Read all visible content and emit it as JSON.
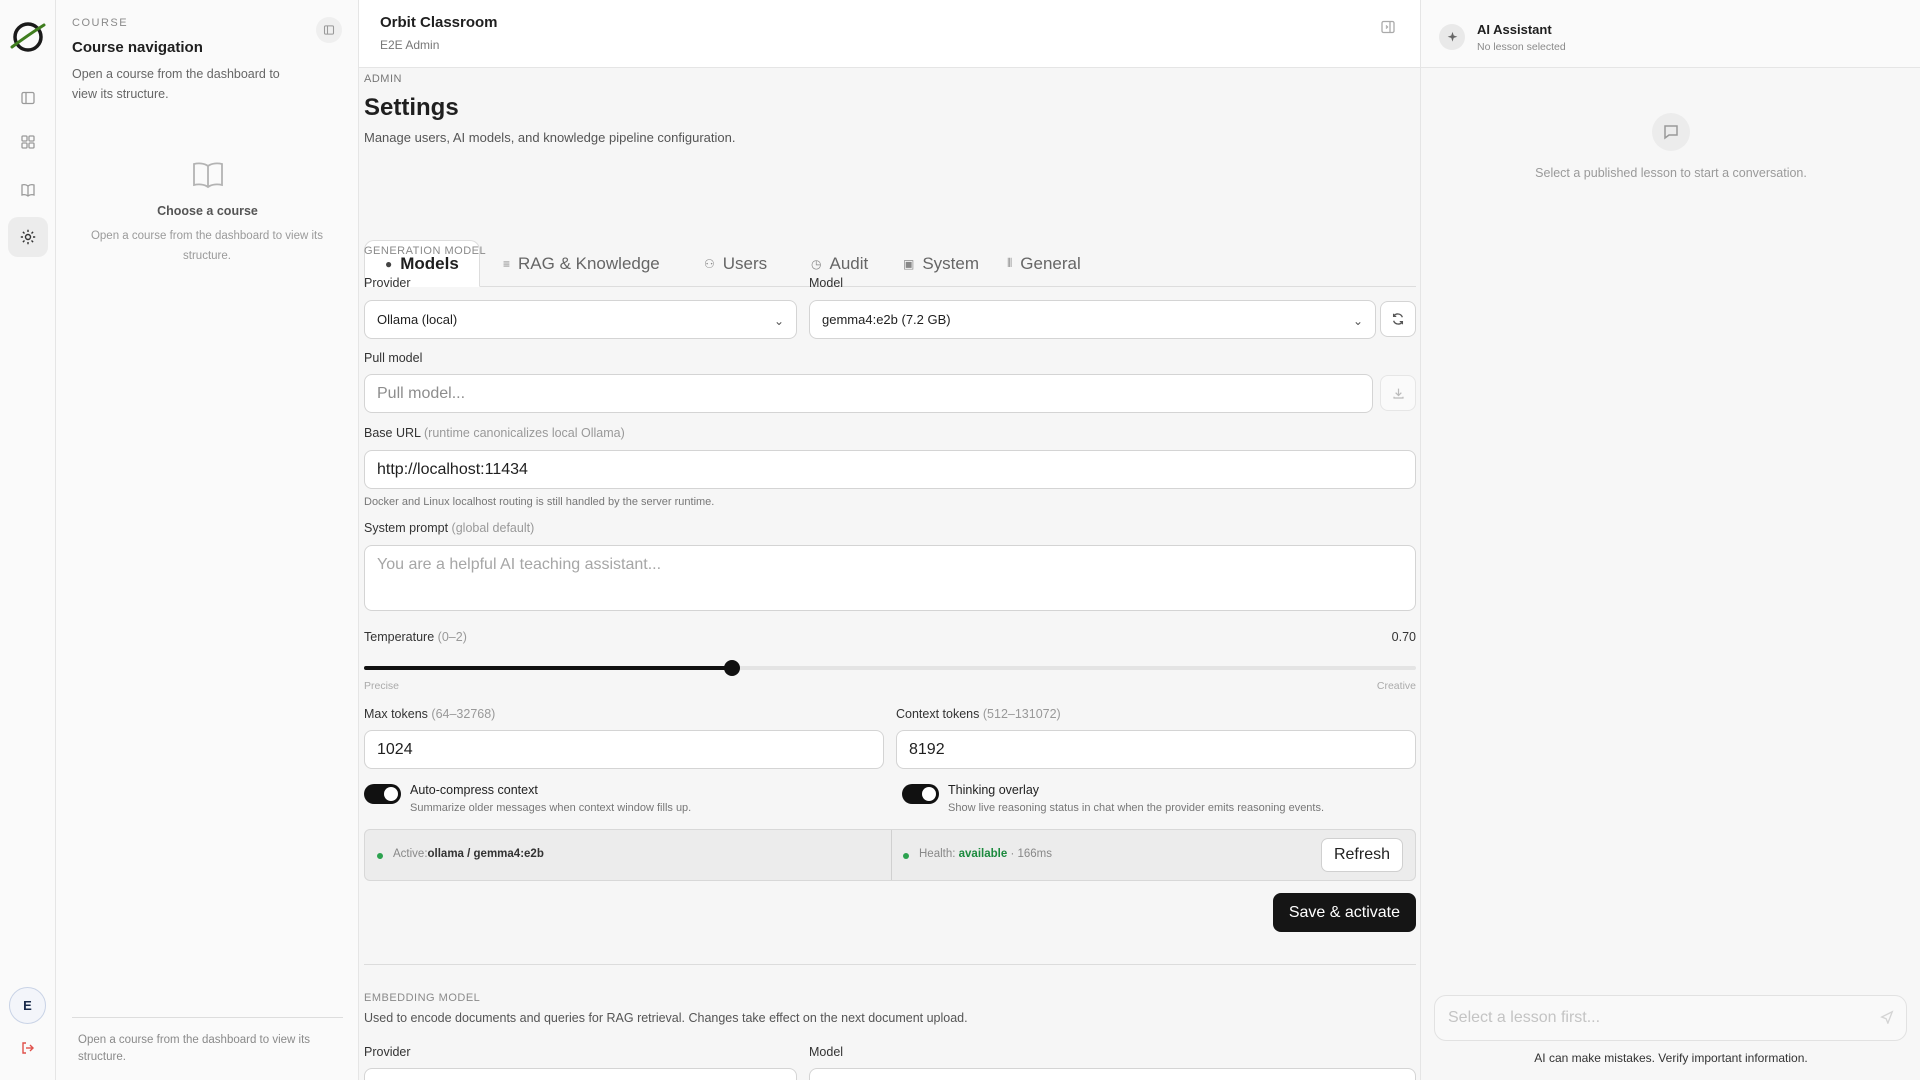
{
  "course_panel": {
    "eyebrow": "COURSE",
    "title": "Course navigation",
    "description": "Open a course from the dashboard to view its structure.",
    "empty_title": "Choose a course",
    "empty_description": "Open a course from the dashboard to view its structure.",
    "footer": "Open a course from the dashboard to view its structure."
  },
  "rail": {
    "avatar_initial": "E",
    "icons": [
      "sidebar-toggle-icon",
      "dashboard-icon",
      "book-icon",
      "settings-icon",
      "logout-icon"
    ]
  },
  "header": {
    "app_title": "Orbit Classroom",
    "user": "E2E Admin"
  },
  "page": {
    "eyebrow": "ADMIN",
    "title": "Settings",
    "description": "Manage users, AI models, and knowledge pipeline configuration."
  },
  "tabs": [
    {
      "label": "Models",
      "icon": "chip-icon",
      "active": true
    },
    {
      "label": "RAG & Knowledge",
      "icon": "database-icon",
      "active": false
    },
    {
      "label": "Users",
      "icon": "users-icon",
      "active": false
    },
    {
      "label": "Audit",
      "icon": "clock-icon",
      "active": false
    },
    {
      "label": "System",
      "icon": "terminal-icon",
      "active": false
    },
    {
      "label": "General",
      "icon": "sliders-icon",
      "active": false
    }
  ],
  "generation": {
    "section_label": "GENERATION MODEL",
    "provider_label": "Provider",
    "provider_value": "Ollama (local)",
    "model_label": "Model",
    "model_value": "gemma4:e2b (7.2 GB)",
    "pull_label": "Pull model",
    "pull_placeholder": "Pull model...",
    "base_url_label": "Base URL",
    "base_url_hint": "(runtime canonicalizes local Ollama)",
    "base_url_value": "http://localhost:11434",
    "base_url_helper": "Docker and Linux localhost routing is still handled by the server runtime.",
    "system_prompt_label": "System prompt",
    "system_prompt_hint": "(global default)",
    "system_prompt_placeholder": "You are a helpful AI teaching assistant...",
    "temperature_label": "Temperature",
    "temperature_hint": "(0–2)",
    "temperature_value": "0.70",
    "temperature_fraction": 0.35,
    "temperature_min_label": "Precise",
    "temperature_max_label": "Creative",
    "max_tokens_label": "Max tokens",
    "max_tokens_hint": "(64–32768)",
    "max_tokens_value": "1024",
    "context_tokens_label": "Context tokens",
    "context_tokens_hint": "(512–131072)",
    "context_tokens_value": "8192",
    "auto_compress_title": "Auto-compress context",
    "auto_compress_desc": "Summarize older messages when context window fills up.",
    "auto_compress_on": true,
    "thinking_title": "Thinking overlay",
    "thinking_desc": "Show live reasoning status in chat when the provider emits reasoning events.",
    "thinking_on": true,
    "active_label": "Active:",
    "active_value": "ollama / gemma4:e2b",
    "health_label": "Health:",
    "health_value": "available",
    "health_latency": "· 166ms",
    "refresh_label": "Refresh",
    "save_label": "Save & activate"
  },
  "embedding": {
    "section_label": "EMBEDDING MODEL",
    "description": "Used to encode documents and queries for RAG retrieval. Changes take effect on the next document upload.",
    "provider_label": "Provider",
    "model_label": "Model"
  },
  "assistant": {
    "title": "AI Assistant",
    "subtitle": "No lesson selected",
    "empty_text": "Select a published lesson to start a conversation.",
    "input_placeholder": "Select a lesson first...",
    "disclaimer": "AI can make mistakes. Verify important information."
  },
  "colors": {
    "accent_dark": "#151515",
    "status_green": "#2ca24f",
    "logout_red": "#e0504a"
  }
}
